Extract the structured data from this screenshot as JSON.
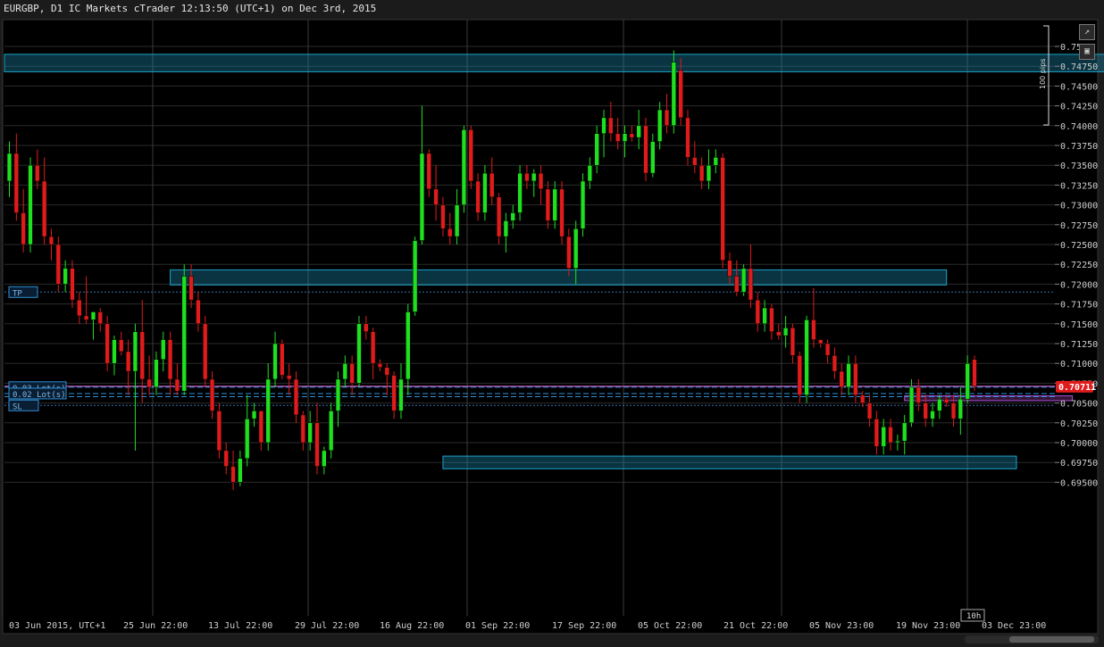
{
  "header": {
    "title": "EURGBP, D1 IC Markets cTrader 12:13:50 (UTC+1) on Dec 3rd, 2015"
  },
  "toolbar": {
    "detach_icon": "external-link-icon",
    "screenshot_icon": "camera-icon"
  },
  "colors": {
    "background": "#000000",
    "grid": "#2b2b2b",
    "bull": "#1fe01f",
    "bear": "#e01b1b",
    "zone": "#1aa3c9",
    "zone_fill": "rgba(30,150,190,0.35)",
    "price_line": "#b04fa8",
    "price_badge": "#e01b1b",
    "order_line": "#2f8fd6",
    "tp_sl_line": "#3a6ea8"
  },
  "chart_data": {
    "type": "candlestick",
    "symbol": "EURGBP",
    "timeframe": "D1",
    "ylim": [
      0.6945,
      0.7515
    ],
    "y_ticks": [
      "0.75",
      "0.74750",
      "0.74500",
      "0.74250",
      "0.74000",
      "0.73750",
      "0.73500",
      "0.73250",
      "0.73000",
      "0.72750",
      "0.72500",
      "0.72250",
      "0.72000",
      "0.71750",
      "0.71500",
      "0.71250",
      "0.71000",
      "0.70750",
      "0.70500",
      "0.70250",
      "0.70000",
      "0.69750",
      "0.69500"
    ],
    "x_ticks": [
      "03 Jun 2015, UTC+1",
      "25 Jun 22:00",
      "13 Jul 22:00",
      "29 Jul 22:00",
      "16 Aug 22:00",
      "01 Sep 22:00",
      "17 Sep 22:00",
      "05 Oct 22:00",
      "21 Oct 22:00",
      "05 Nov 23:00",
      "19 Nov 23:00",
      "03 Dec 23:00"
    ],
    "current_price": "0.70711",
    "current_price_value": 0.70711,
    "candle_timer": "10h",
    "scale_label": "100 pips",
    "order_labels": [
      "0.03 Lot(s)",
      "0.02 Lot(s)"
    ],
    "tp_label": "TP",
    "sl_label": "SL",
    "tp_price": 0.719,
    "sl_price": 0.7047,
    "order_prices": [
      0.707,
      0.7062,
      0.7058
    ],
    "zones": [
      {
        "x_start": 0,
        "x_end": 163,
        "y_low": 0.7468,
        "y_high": 0.749
      },
      {
        "x_start": 23,
        "x_end": 134,
        "y_low": 0.7199,
        "y_high": 0.7218
      },
      {
        "x_start": 62,
        "x_end": 144,
        "y_low": 0.6967,
        "y_high": 0.6983
      },
      {
        "x_start": 128,
        "x_end": 152,
        "y_low": 0.7053,
        "y_high": 0.7059
      }
    ],
    "candles": [
      [
        0.733,
        0.738,
        0.731,
        0.7365
      ],
      [
        0.7365,
        0.739,
        0.728,
        0.729
      ],
      [
        0.729,
        0.732,
        0.724,
        0.725
      ],
      [
        0.725,
        0.736,
        0.724,
        0.735
      ],
      [
        0.735,
        0.737,
        0.732,
        0.733
      ],
      [
        0.733,
        0.736,
        0.725,
        0.726
      ],
      [
        0.726,
        0.727,
        0.723,
        0.725
      ],
      [
        0.725,
        0.726,
        0.719,
        0.72
      ],
      [
        0.72,
        0.723,
        0.719,
        0.722
      ],
      [
        0.722,
        0.723,
        0.717,
        0.718
      ],
      [
        0.718,
        0.719,
        0.715,
        0.716
      ],
      [
        0.716,
        0.721,
        0.715,
        0.7155
      ],
      [
        0.7155,
        0.7165,
        0.713,
        0.7165
      ],
      [
        0.7165,
        0.717,
        0.714,
        0.715
      ],
      [
        0.715,
        0.716,
        0.709,
        0.71
      ],
      [
        0.71,
        0.7135,
        0.7085,
        0.713
      ],
      [
        0.713,
        0.714,
        0.711,
        0.7115
      ],
      [
        0.7115,
        0.713,
        0.706,
        0.709
      ],
      [
        0.709,
        0.715,
        0.699,
        0.714
      ],
      [
        0.714,
        0.718,
        0.705,
        0.708
      ],
      [
        0.708,
        0.711,
        0.706,
        0.707
      ],
      [
        0.707,
        0.7115,
        0.706,
        0.7105
      ],
      [
        0.7105,
        0.714,
        0.709,
        0.713
      ],
      [
        0.713,
        0.714,
        0.706,
        0.708
      ],
      [
        0.708,
        0.71,
        0.706,
        0.7065
      ],
      [
        0.7065,
        0.7225,
        0.706,
        0.721
      ],
      [
        0.721,
        0.7225,
        0.717,
        0.718
      ],
      [
        0.718,
        0.719,
        0.714,
        0.715
      ],
      [
        0.715,
        0.716,
        0.707,
        0.708
      ],
      [
        0.708,
        0.709,
        0.703,
        0.704
      ],
      [
        0.704,
        0.705,
        0.698,
        0.699
      ],
      [
        0.699,
        0.7,
        0.696,
        0.697
      ],
      [
        0.697,
        0.699,
        0.694,
        0.695
      ],
      [
        0.695,
        0.699,
        0.6945,
        0.698
      ],
      [
        0.698,
        0.706,
        0.697,
        0.703
      ],
      [
        0.703,
        0.705,
        0.702,
        0.704
      ],
      [
        0.704,
        0.704,
        0.699,
        0.7
      ],
      [
        0.7,
        0.71,
        0.699,
        0.708
      ],
      [
        0.708,
        0.714,
        0.707,
        0.7125
      ],
      [
        0.7125,
        0.713,
        0.708,
        0.7085
      ],
      [
        0.7085,
        0.71,
        0.706,
        0.708
      ],
      [
        0.708,
        0.709,
        0.7025,
        0.7035
      ],
      [
        0.7035,
        0.704,
        0.699,
        0.7
      ],
      [
        0.7,
        0.704,
        0.699,
        0.7025
      ],
      [
        0.7025,
        0.705,
        0.696,
        0.697
      ],
      [
        0.697,
        0.6995,
        0.696,
        0.699
      ],
      [
        0.699,
        0.705,
        0.698,
        0.704
      ],
      [
        0.704,
        0.709,
        0.702,
        0.708
      ],
      [
        0.708,
        0.711,
        0.707,
        0.71
      ],
      [
        0.71,
        0.711,
        0.706,
        0.7075
      ],
      [
        0.7075,
        0.716,
        0.707,
        0.715
      ],
      [
        0.715,
        0.716,
        0.713,
        0.714
      ],
      [
        0.714,
        0.7145,
        0.708,
        0.71
      ],
      [
        0.71,
        0.7105,
        0.709,
        0.7095
      ],
      [
        0.7095,
        0.71,
        0.706,
        0.7085
      ],
      [
        0.7085,
        0.709,
        0.703,
        0.704
      ],
      [
        0.704,
        0.71,
        0.703,
        0.708
      ],
      [
        0.708,
        0.7175,
        0.706,
        0.7165
      ],
      [
        0.7165,
        0.726,
        0.716,
        0.7255
      ],
      [
        0.7255,
        0.7425,
        0.725,
        0.7365
      ],
      [
        0.7365,
        0.737,
        0.731,
        0.732
      ],
      [
        0.732,
        0.735,
        0.728,
        0.73
      ],
      [
        0.73,
        0.731,
        0.726,
        0.727
      ],
      [
        0.727,
        0.729,
        0.725,
        0.726
      ],
      [
        0.726,
        0.732,
        0.725,
        0.73
      ],
      [
        0.73,
        0.74,
        0.729,
        0.7395
      ],
      [
        0.7395,
        0.74,
        0.732,
        0.733
      ],
      [
        0.733,
        0.734,
        0.728,
        0.729
      ],
      [
        0.729,
        0.735,
        0.728,
        0.734
      ],
      [
        0.734,
        0.736,
        0.73,
        0.731
      ],
      [
        0.731,
        0.7315,
        0.725,
        0.726
      ],
      [
        0.726,
        0.729,
        0.724,
        0.728
      ],
      [
        0.728,
        0.73,
        0.727,
        0.729
      ],
      [
        0.729,
        0.735,
        0.728,
        0.734
      ],
      [
        0.734,
        0.735,
        0.732,
        0.733
      ],
      [
        0.733,
        0.7345,
        0.731,
        0.734
      ],
      [
        0.734,
        0.735,
        0.73,
        0.732
      ],
      [
        0.732,
        0.733,
        0.727,
        0.728
      ],
      [
        0.728,
        0.733,
        0.727,
        0.732
      ],
      [
        0.732,
        0.733,
        0.725,
        0.726
      ],
      [
        0.726,
        0.727,
        0.721,
        0.722
      ],
      [
        0.722,
        0.728,
        0.72,
        0.727
      ],
      [
        0.727,
        0.734,
        0.726,
        0.733
      ],
      [
        0.733,
        0.736,
        0.732,
        0.735
      ],
      [
        0.735,
        0.74,
        0.734,
        0.739
      ],
      [
        0.739,
        0.742,
        0.736,
        0.741
      ],
      [
        0.741,
        0.743,
        0.738,
        0.739
      ],
      [
        0.739,
        0.741,
        0.737,
        0.738
      ],
      [
        0.738,
        0.74,
        0.736,
        0.739
      ],
      [
        0.739,
        0.74,
        0.738,
        0.7385
      ],
      [
        0.7385,
        0.742,
        0.737,
        0.74
      ],
      [
        0.74,
        0.741,
        0.733,
        0.734
      ],
      [
        0.734,
        0.739,
        0.7335,
        0.738
      ],
      [
        0.738,
        0.743,
        0.737,
        0.742
      ],
      [
        0.742,
        0.744,
        0.739,
        0.74
      ],
      [
        0.74,
        0.7495,
        0.739,
        0.748
      ],
      [
        0.747,
        0.7485,
        0.74,
        0.741
      ],
      [
        0.741,
        0.742,
        0.735,
        0.736
      ],
      [
        0.736,
        0.738,
        0.734,
        0.735
      ],
      [
        0.735,
        0.736,
        0.732,
        0.733
      ],
      [
        0.733,
        0.737,
        0.732,
        0.735
      ],
      [
        0.735,
        0.737,
        0.734,
        0.736
      ],
      [
        0.736,
        0.7365,
        0.722,
        0.723
      ],
      [
        0.723,
        0.724,
        0.72,
        0.721
      ],
      [
        0.721,
        0.723,
        0.7185,
        0.719
      ],
      [
        0.719,
        0.7225,
        0.7185,
        0.722
      ],
      [
        0.722,
        0.725,
        0.717,
        0.718
      ],
      [
        0.718,
        0.719,
        0.714,
        0.715
      ],
      [
        0.715,
        0.718,
        0.714,
        0.717
      ],
      [
        0.717,
        0.7175,
        0.713,
        0.714
      ],
      [
        0.714,
        0.715,
        0.713,
        0.7135
      ],
      [
        0.7135,
        0.716,
        0.712,
        0.7145
      ],
      [
        0.7145,
        0.715,
        0.71,
        0.711
      ],
      [
        0.711,
        0.7115,
        0.705,
        0.706
      ],
      [
        0.706,
        0.716,
        0.705,
        0.7155
      ],
      [
        0.7155,
        0.7195,
        0.712,
        0.713
      ],
      [
        0.713,
        0.713,
        0.712,
        0.7125
      ],
      [
        0.7125,
        0.713,
        0.71,
        0.711
      ],
      [
        0.711,
        0.712,
        0.708,
        0.709
      ],
      [
        0.709,
        0.71,
        0.706,
        0.707
      ],
      [
        0.707,
        0.711,
        0.706,
        0.71
      ],
      [
        0.71,
        0.711,
        0.705,
        0.706
      ],
      [
        0.706,
        0.7065,
        0.7045,
        0.705
      ],
      [
        0.705,
        0.706,
        0.702,
        0.703
      ],
      [
        0.703,
        0.704,
        0.6985,
        0.6995
      ],
      [
        0.6995,
        0.703,
        0.6985,
        0.702
      ],
      [
        0.702,
        0.703,
        0.699,
        0.7
      ],
      [
        0.7,
        0.701,
        0.699,
        0.7002
      ],
      [
        0.7002,
        0.7035,
        0.6985,
        0.7025
      ],
      [
        0.7025,
        0.708,
        0.702,
        0.707
      ],
      [
        0.707,
        0.708,
        0.704,
        0.705
      ],
      [
        0.705,
        0.706,
        0.702,
        0.703
      ],
      [
        0.703,
        0.705,
        0.702,
        0.704
      ],
      [
        0.704,
        0.706,
        0.703,
        0.7055
      ],
      [
        0.7055,
        0.706,
        0.7045,
        0.705
      ],
      [
        0.705,
        0.706,
        0.702,
        0.703
      ],
      [
        0.703,
        0.707,
        0.701,
        0.7055
      ],
      [
        0.7055,
        0.711,
        0.705,
        0.71
      ],
      [
        0.7105,
        0.711,
        0.7065,
        0.7071
      ]
    ]
  }
}
